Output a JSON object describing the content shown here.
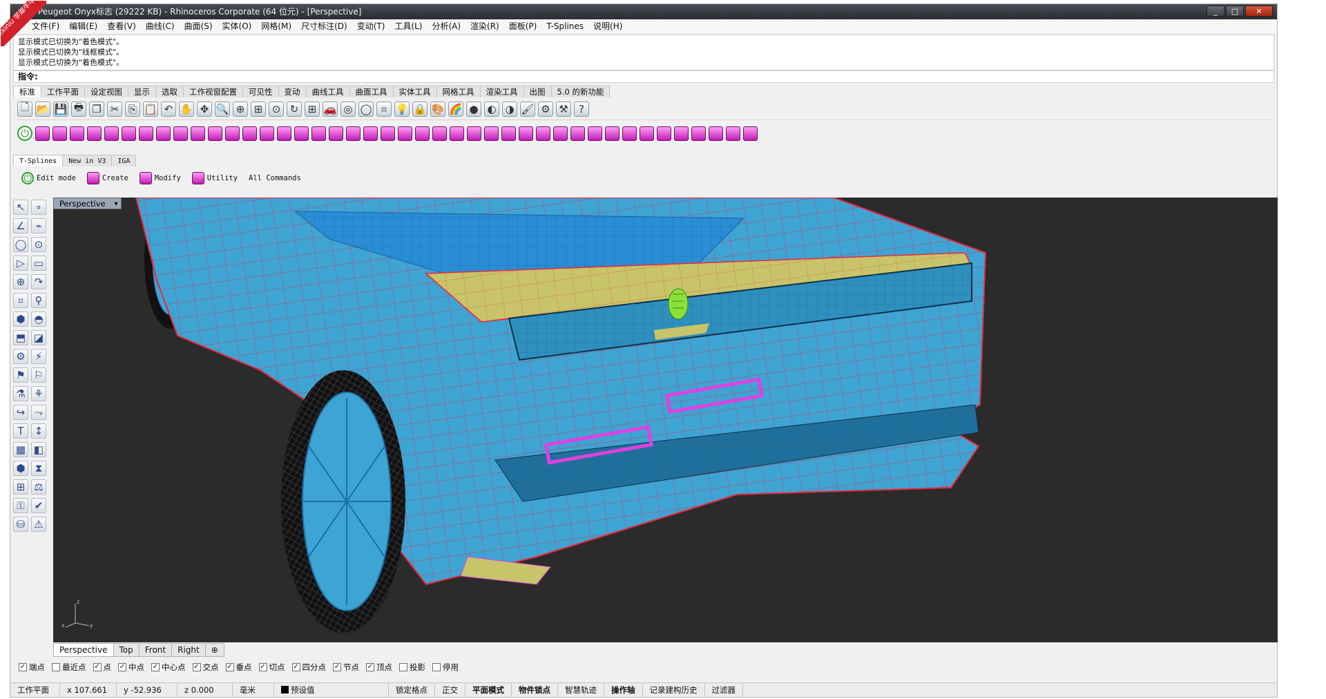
{
  "window": {
    "title": "Peugeot Onyx标志 (29222 KB) - Rhinoceros Corporate (64 位元) - [Perspective]",
    "controls": [
      "_",
      "□",
      "✕"
    ]
  },
  "badge": {
    "text": "xuexiniu 学犀牛中文网"
  },
  "menu": [
    "文件(F)",
    "编辑(E)",
    "查看(V)",
    "曲线(C)",
    "曲面(S)",
    "实体(O)",
    "网格(M)",
    "尺寸标注(D)",
    "变动(T)",
    "工具(L)",
    "分析(A)",
    "渲染(R)",
    "面板(P)",
    "T-Splines",
    "说明(H)"
  ],
  "history": [
    "显示模式已切换为\"着色模式\"。",
    "显示模式已切换为\"线框模式\"。",
    "显示模式已切换为\"着色模式\"。"
  ],
  "command": {
    "label": "指令:"
  },
  "main_tabs": [
    "标准",
    "工作平面",
    "设定视图",
    "显示",
    "选取",
    "工作视窗配置",
    "可见性",
    "变动",
    "曲线工具",
    "曲面工具",
    "实体工具",
    "网格工具",
    "渲染工具",
    "出图",
    "5.0 的新功能"
  ],
  "std_icons": [
    "new-file-icon",
    "open-icon",
    "save-icon",
    "print-icon",
    "copy-window-icon",
    "cut-icon",
    "copy-icon",
    "paste-icon",
    "undo-icon",
    "pan-icon",
    "move-view-icon",
    "zoom-icon",
    "zoom-window-icon",
    "zoom-extents-icon",
    "zoom-selected-icon",
    "rotate-view-icon",
    "four-views-icon",
    "car-icon",
    "cplane-icon",
    "sphere-icon",
    "grid-snap-icon",
    "light-icon",
    "lock-icon",
    "material-icon",
    "color-icon",
    "render-sphere-icon",
    "shade-icon",
    "render-icon",
    "brush-icon",
    "gear-icon",
    "options-icon",
    "help-icon"
  ],
  "std_glyphs": [
    "🗋",
    "📂",
    "💾",
    "🖶",
    "❐",
    "✂",
    "⎘",
    "📋",
    "↶",
    "✋",
    "✥",
    "🔍",
    "⊕",
    "⊞",
    "⊙",
    "↻",
    "⊞",
    "🚗",
    "◎",
    "◯",
    "⌗",
    "💡",
    "🔒",
    "🎨",
    "🌈",
    "●",
    "◐",
    "◑",
    "🖌",
    "⚙",
    "⚒",
    "?"
  ],
  "ts_icons_count": 42,
  "ts_tabs": [
    "T-Splines",
    "New in V3",
    "IGA"
  ],
  "ts_buttons": [
    {
      "name": "edit-mode-button",
      "label": "Edit mode",
      "icon": "power-icon"
    },
    {
      "name": "create-button",
      "label": "Create",
      "icon": "box-icon"
    },
    {
      "name": "modify-button",
      "label": "Modify",
      "icon": "modify-icon"
    },
    {
      "name": "utility-button",
      "label": "Utility",
      "icon": "utility-icon"
    },
    {
      "name": "all-commands-button",
      "label": "All Commands",
      "icon": ""
    }
  ],
  "left_tools": [
    "↖",
    "∘",
    "∠",
    "⌁",
    "◯",
    "⊙",
    "▷",
    "▭",
    "⊕",
    "↷",
    "⌗",
    "⚲",
    "⬢",
    "◓",
    "⬒",
    "◪",
    "⚙",
    "⚡",
    "⚑",
    "⚐",
    "⚗",
    "⚘",
    "↪",
    "⤳",
    "T",
    "↕",
    "▦",
    "◧",
    "⬢",
    "⧗",
    "⊞",
    "⚖",
    "⚿",
    "✔",
    "⛁",
    "⚠"
  ],
  "viewport": {
    "label": "Perspective",
    "axes": {
      "z": "z",
      "x": "x",
      "y": "y"
    },
    "background": "#2b2b2b",
    "model_color": "#3ea4d4",
    "edge_color": "#e8283c",
    "highlight_color": "#c8c46a",
    "accent_pink": "#e040e0"
  },
  "view_tabs": [
    "Perspective",
    "Top",
    "Front",
    "Right",
    "⊕"
  ],
  "osnaps": [
    {
      "label": "端点",
      "checked": true
    },
    {
      "label": "最近点",
      "checked": false
    },
    {
      "label": "点",
      "checked": true
    },
    {
      "label": "中点",
      "checked": true
    },
    {
      "label": "中心点",
      "checked": true
    },
    {
      "label": "交点",
      "checked": true
    },
    {
      "label": "垂点",
      "checked": true
    },
    {
      "label": "切点",
      "checked": true
    },
    {
      "label": "四分点",
      "checked": true
    },
    {
      "label": "节点",
      "checked": true
    },
    {
      "label": "顶点",
      "checked": true
    },
    {
      "label": "投影",
      "checked": false
    },
    {
      "label": "停用",
      "checked": false
    }
  ],
  "status": {
    "cplane": "工作平面",
    "x": "x 107.661",
    "y": "y -52.936",
    "z": "z 0.000",
    "units": "毫米",
    "layer": "预设值",
    "toggles": [
      {
        "label": "锁定格点",
        "bold": false
      },
      {
        "label": "正交",
        "bold": false
      },
      {
        "label": "平面模式",
        "bold": true
      },
      {
        "label": "物件锁点",
        "bold": true
      },
      {
        "label": "智慧轨迹",
        "bold": false
      },
      {
        "label": "操作轴",
        "bold": true
      },
      {
        "label": "记录建构历史",
        "bold": false
      },
      {
        "label": "过滤器",
        "bold": false
      }
    ]
  }
}
